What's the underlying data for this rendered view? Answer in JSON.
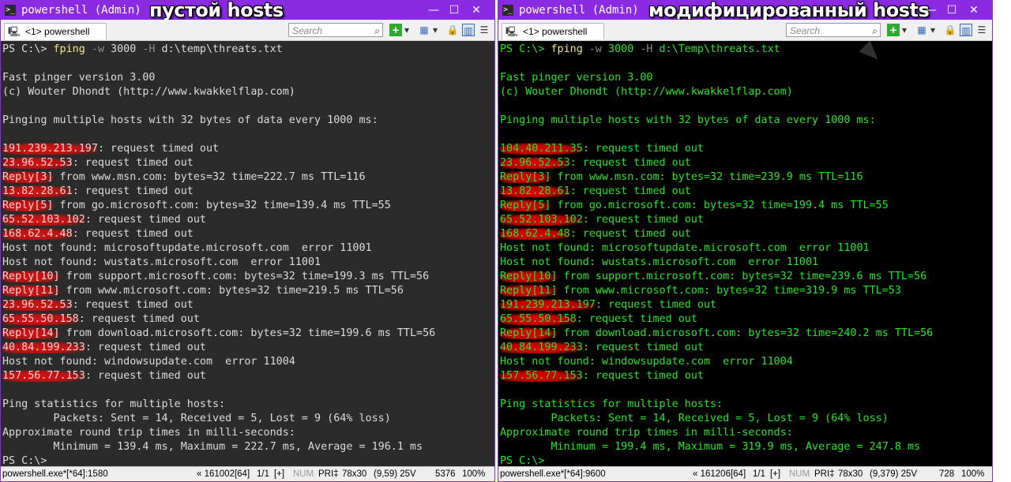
{
  "windows": [
    {
      "title": "powershell (Admin)",
      "overlay_label": "пустой hosts",
      "tab_label": "<1> powershell",
      "search_placeholder": "Search",
      "lines": [
        [
          {
            "t": "PS C:\\> "
          },
          {
            "t": "fping",
            "c": "cmd"
          },
          {
            "t": " "
          },
          {
            "t": "-w",
            "c": "param"
          },
          {
            "t": " 3000 "
          },
          {
            "t": "-H",
            "c": "param"
          },
          {
            "t": " d:\\temp\\threats.txt"
          }
        ],
        [],
        [
          {
            "t": "Fast pinger version 3.00"
          }
        ],
        [
          {
            "t": "(c) Wouter Dhondt (http://www.kwakkelflap.com)"
          }
        ],
        [],
        [
          {
            "t": "Pinging multiple hosts with 32 bytes of data every 1000 ms:"
          }
        ],
        [],
        [
          {
            "t": "191.239.213.197",
            "c": "hl"
          },
          {
            "t": ": request timed out"
          }
        ],
        [
          {
            "t": "23.96.52.53",
            "c": "hl"
          },
          {
            "t": ": request timed out"
          }
        ],
        [
          {
            "t": "Reply[3]",
            "c": "hl"
          },
          {
            "t": " from www.msn.com: bytes=32 time=222.7 ms TTL=116"
          }
        ],
        [
          {
            "t": "13.82.28.61",
            "c": "hl"
          },
          {
            "t": ": request timed out"
          }
        ],
        [
          {
            "t": "Reply[5]",
            "c": "hl"
          },
          {
            "t": " from go.microsoft.com: bytes=32 time=139.4 ms TTL=55"
          }
        ],
        [
          {
            "t": "65.52.103.102",
            "c": "hl"
          },
          {
            "t": ": request timed out"
          }
        ],
        [
          {
            "t": "168.62.4.48",
            "c": "hl"
          },
          {
            "t": ": request timed out"
          }
        ],
        [
          {
            "t": "Host not found: microsoftupdate.microsoft.com  error 11001"
          }
        ],
        [
          {
            "t": "Host not found: wustats.microsoft.com  error 11001"
          }
        ],
        [
          {
            "t": "Reply[10]",
            "c": "hl"
          },
          {
            "t": " from support.microsoft.com: bytes=32 time=199.3 ms TTL=56"
          }
        ],
        [
          {
            "t": "Reply[11]",
            "c": "hl"
          },
          {
            "t": " from www.microsoft.com: bytes=32 time=219.5 ms TTL=56"
          }
        ],
        [
          {
            "t": "23.96.52.53",
            "c": "hl"
          },
          {
            "t": ": request timed out"
          }
        ],
        [
          {
            "t": "65.55.50.158",
            "c": "hl"
          },
          {
            "t": ": request timed out"
          }
        ],
        [
          {
            "t": "Reply[14]",
            "c": "hl"
          },
          {
            "t": " from download.microsoft.com: bytes=32 time=199.6 ms TTL=56"
          }
        ],
        [
          {
            "t": "40.84.199.233",
            "c": "hl"
          },
          {
            "t": ": request timed out"
          }
        ],
        [
          {
            "t": "Host not found: windowsupdate.com  error 11004"
          }
        ],
        [
          {
            "t": "157.56.77.153",
            "c": "hl"
          },
          {
            "t": ": request timed out"
          }
        ],
        [],
        [
          {
            "t": "Ping statistics for multiple hosts:"
          }
        ],
        [
          {
            "t": "        Packets: Sent = 14, Received = 5, Lost = 9 (64% loss)"
          }
        ],
        [
          {
            "t": "Approximate round trip times in milli-seconds:"
          }
        ],
        [
          {
            "t": "        Minimum = 139.4 ms, Maximum = 222.7 ms, Average = 196.1 ms"
          }
        ],
        [
          {
            "t": "PS C:\\>"
          }
        ]
      ],
      "status": {
        "exe": "powershell.exe*[*64]:1580",
        "a": "« 161002[64]",
        "b": "1/1",
        "c": "[+]",
        "d": "NUM",
        "e": "PRI‡",
        "f": "78x30",
        "g": "(9,59) 25V",
        "h": "5376",
        "i": "100%"
      }
    },
    {
      "title": "powershell (Admin)",
      "overlay_label": "модифицированный hosts",
      "tab_label": "<1> powershell",
      "search_placeholder": "Search",
      "lines": [
        [
          {
            "t": "PS C:\\> "
          },
          {
            "t": "fping",
            "c": "cmd"
          },
          {
            "t": " "
          },
          {
            "t": "-w",
            "c": "param"
          },
          {
            "t": " 3000 "
          },
          {
            "t": "-H",
            "c": "param"
          },
          {
            "t": " d:\\Temp\\threats.txt"
          }
        ],
        [],
        [
          {
            "t": "Fast pinger version 3.00"
          }
        ],
        [
          {
            "t": "(c) Wouter Dhondt (http://www.kwakkelflap.com)"
          }
        ],
        [],
        [
          {
            "t": "Pinging multiple hosts with 32 bytes of data every 1000 ms:"
          }
        ],
        [],
        [
          {
            "t": "104.40.211.35",
            "c": "hl"
          },
          {
            "t": ": request timed out"
          }
        ],
        [
          {
            "t": "23.96.52.53",
            "c": "hl"
          },
          {
            "t": ": request timed out"
          }
        ],
        [
          {
            "t": "Reply[3]",
            "c": "hl"
          },
          {
            "t": " from www.msn.com: bytes=32 time=239.9 ms TTL=116"
          }
        ],
        [
          {
            "t": "13.82.28.61",
            "c": "hl"
          },
          {
            "t": ": request timed out"
          }
        ],
        [
          {
            "t": "Reply[5]",
            "c": "hl"
          },
          {
            "t": " from go.microsoft.com: bytes=32 time=199.4 ms TTL=55"
          }
        ],
        [
          {
            "t": "65.52.103.102",
            "c": "hl"
          },
          {
            "t": ": request timed out"
          }
        ],
        [
          {
            "t": "168.62.4.48",
            "c": "hl"
          },
          {
            "t": ": request timed out"
          }
        ],
        [
          {
            "t": "Host not found: microsoftupdate.microsoft.com  error 11001"
          }
        ],
        [
          {
            "t": "Host not found: wustats.microsoft.com  error 11001"
          }
        ],
        [
          {
            "t": "Reply[10]",
            "c": "hl"
          },
          {
            "t": " from support.microsoft.com: bytes=32 time=239.6 ms TTL=56"
          }
        ],
        [
          {
            "t": "Reply[11]",
            "c": "hl"
          },
          {
            "t": " from www.microsoft.com: bytes=32 time=319.9 ms TTL=53"
          }
        ],
        [
          {
            "t": "191.239.213.197",
            "c": "hl"
          },
          {
            "t": ": request timed out"
          }
        ],
        [
          {
            "t": "65.55.50.158",
            "c": "hl"
          },
          {
            "t": ": request timed out"
          }
        ],
        [
          {
            "t": "Reply[14]",
            "c": "hl"
          },
          {
            "t": " from download.microsoft.com: bytes=32 time=240.2 ms TTL=56"
          }
        ],
        [
          {
            "t": "40.84.199.233",
            "c": "hl"
          },
          {
            "t": ": request timed out"
          }
        ],
        [
          {
            "t": "Host not found: windowsupdate.com  error 11004"
          }
        ],
        [
          {
            "t": "157.56.77.153",
            "c": "hl"
          },
          {
            "t": ": request timed out"
          }
        ],
        [],
        [
          {
            "t": "Ping statistics for multiple hosts:"
          }
        ],
        [
          {
            "t": "        Packets: Sent = 14, Received = 5, Lost = 9 (64% loss)"
          }
        ],
        [
          {
            "t": "Approximate round trip times in milli-seconds:"
          }
        ],
        [
          {
            "t": "        Minimum = 199.4 ms, Maximum = 319.9 ms, Average = 247.8 ms"
          }
        ],
        [
          {
            "t": "PS C:\\>"
          }
        ]
      ],
      "status": {
        "exe": "powershell.exe*[*64]:9600",
        "a": "« 161206[64]",
        "b": "1/1",
        "c": "[+]",
        "d": "NUM",
        "e": "PRI‡",
        "f": "78x30",
        "g": "(9,379) 25V",
        "h": "728",
        "i": "100%"
      }
    }
  ],
  "icons": {
    "title_icon": "console-icon",
    "tab_icon": "tab-terminal-icon",
    "search": "search-icon",
    "add": "add-console-icon",
    "view": "view-icon",
    "lock": "lock-icon",
    "pane": "pane-icon",
    "menu": "menu-icon",
    "minimize": "minimize-icon",
    "maximize": "maximize-icon",
    "close": "close-icon"
  },
  "colors": {
    "titlebar": "#8a2be2",
    "left_console_bg": "#2b2b2b",
    "right_console_bg": "#000000",
    "right_console_text": "#22e622",
    "highlight": "#dd1414"
  }
}
